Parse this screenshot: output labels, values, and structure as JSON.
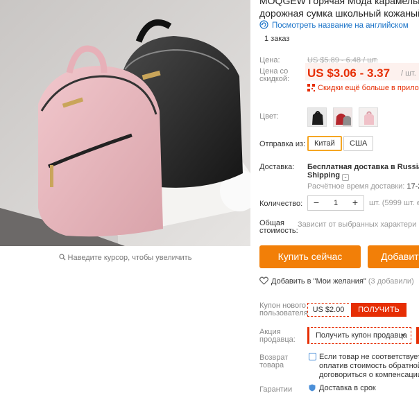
{
  "zoom_hint": "Наведите курсор, чтобы увеличить",
  "product": {
    "title_line1": "MOQGEW Горячая Мода карамельный L",
    "title_line2": "дорожная сумка школьный кожаный Sti",
    "translate_link": "Посмотреть название на английском",
    "orders": "1 заказ"
  },
  "price": {
    "label": "Цена:",
    "old": "US $5.89 - 6.48 / шт.",
    "discount_label_1": "Цена со",
    "discount_label_2": "скидкой:",
    "current": "US $3.06 - 3.37",
    "unit": "/ шт.",
    "app_deal": "Скидки ещё больше в приложе"
  },
  "color": {
    "label": "Цвет:",
    "swatches": [
      "black-backpack",
      "red-backpack",
      "pink-backpack"
    ]
  },
  "ship_from": {
    "label": "Отправка из:",
    "options": [
      "Китай",
      "США"
    ],
    "selected": "Китай"
  },
  "delivery": {
    "label": "Доставка:",
    "line1": "Бесплатная доставка в Russian F",
    "line2": "Shipping",
    "time_label": "Расчётное время доставки:",
    "time_value": "17-22"
  },
  "quantity": {
    "label": "Количество:",
    "value": "1",
    "minus": "−",
    "plus": "+",
    "note": "шт. (5999 шт. ес"
  },
  "total": {
    "label_1": "Общая",
    "label_2": "стоимость:",
    "note": "Зависит от выбранных характери"
  },
  "buttons": {
    "buy_now": "Купить сейчас",
    "add_to_cart": "Добавит"
  },
  "wishlist": {
    "label": "Добавить в \"Мои желания\"",
    "count": "(3 добавили)"
  },
  "coupon": {
    "label_1": "Купон нового",
    "label_2": "пользователя",
    "amount": "US $2.00",
    "get": "ПОЛУЧИТЬ"
  },
  "seller": {
    "label_1": "Акция",
    "label_2": "продавца:",
    "select": "Получить купон продавца"
  },
  "return": {
    "label_1": "Возврат",
    "label_2": "товара",
    "line1": "Если товар не соответствует",
    "line2": "оплатив стоимость обратной п",
    "line3": "договориться о компенсации с"
  },
  "guarantee": {
    "label": "Гарантии",
    "text": "Доставка в срок"
  },
  "colors": {
    "accent": "#e62e04",
    "button": "#f27f08",
    "link": "#1a73c8",
    "chip_active": "#f5a623"
  }
}
